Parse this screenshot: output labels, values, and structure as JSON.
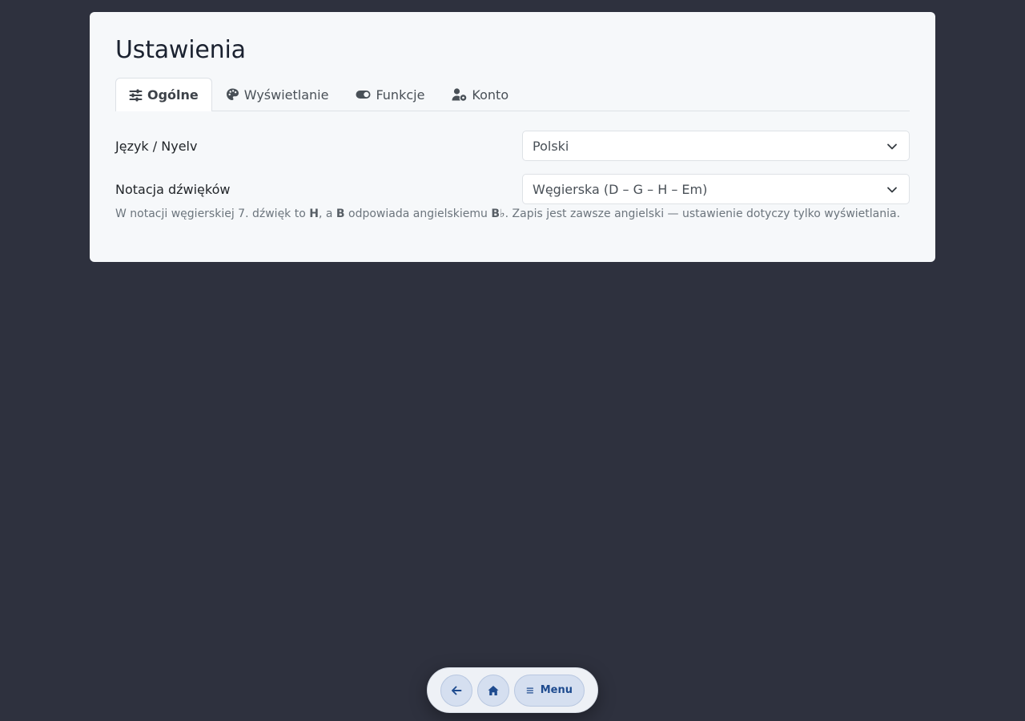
{
  "page": {
    "title": "Ustawienia"
  },
  "tabs": [
    {
      "label": "Ogólne",
      "icon": "sliders-icon",
      "active": true
    },
    {
      "label": "Wyświetlanie",
      "icon": "palette-icon",
      "active": false
    },
    {
      "label": "Funkcje",
      "icon": "toggle-icon",
      "active": false
    },
    {
      "label": "Konto",
      "icon": "user-gear-icon",
      "active": false
    }
  ],
  "settings": {
    "language": {
      "label": "Język / Nyelv",
      "value": "Polski"
    },
    "notation": {
      "label": "Notacja dźwięków",
      "value": "Węgierska (D – G – H – Em)"
    },
    "help": {
      "part1": "W notacji węgierskiej 7. dźwięk to ",
      "note_h": "H",
      "part2": ", a ",
      "note_b": "B",
      "part3": " odpowiada angielskiemu ",
      "note_bflat": "B♭",
      "part4": ". Zapis jest zawsze angielski — ustawienie dotyczy tylko wyświetlania."
    }
  },
  "nav": {
    "menu_label": "Menu"
  },
  "colors": {
    "background": "#2e313e",
    "card": "#f6f8fa",
    "accent": "#1e4b8f"
  }
}
